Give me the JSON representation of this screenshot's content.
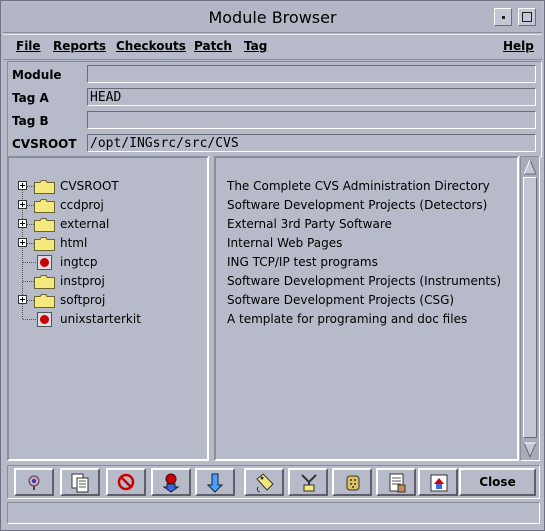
{
  "window": {
    "title": "Module Browser"
  },
  "menus": [
    {
      "label": "File"
    },
    {
      "label": "Reports"
    },
    {
      "label": "Checkouts"
    },
    {
      "label": "Patch"
    },
    {
      "label": "Tag"
    },
    {
      "label": "Help"
    }
  ],
  "fields": {
    "module": {
      "label": "Module",
      "value": ""
    },
    "tag_a": {
      "label": "Tag A",
      "value": "HEAD"
    },
    "tag_b": {
      "label": "Tag B",
      "value": ""
    },
    "cvsroot": {
      "label": "CVSROOT",
      "value": "/opt/INGsrc/src/CVS"
    }
  },
  "modules": [
    {
      "name": "CVSROOT",
      "description": "The Complete CVS Administration Directory",
      "type": "folder",
      "expandable": true
    },
    {
      "name": "ccdproj",
      "description": "Software Development Projects (Detectors)",
      "type": "folder",
      "expandable": true
    },
    {
      "name": "external",
      "description": "External 3rd Party Software",
      "type": "folder",
      "expandable": true
    },
    {
      "name": "html",
      "description": "Internal Web Pages",
      "type": "folder",
      "expandable": true
    },
    {
      "name": "ingtcp",
      "description": "ING TCP/IP test programs",
      "type": "module",
      "expandable": false
    },
    {
      "name": "instproj",
      "description": "Software Development Projects (Instruments)",
      "type": "folder",
      "expandable": false
    },
    {
      "name": "softproj",
      "description": "Software Development Projects (CSG)",
      "type": "folder",
      "expandable": true
    },
    {
      "name": "unixstarterkit",
      "description": "A template for programing and doc files",
      "type": "module",
      "expandable": false
    }
  ],
  "toolbar": {
    "icons": [
      "who-icon",
      "file-list-icon",
      "delete-icon",
      "import-icon",
      "checkout-icon",
      "tag-icon",
      "merge-icon",
      "patch-icon",
      "report-icon",
      "home-icon"
    ],
    "close_label": "Close"
  },
  "status": {
    "text": ""
  },
  "colors": {
    "background": "#b7bac9",
    "folder": "#f4e97c",
    "module_dot": "#c80000"
  }
}
